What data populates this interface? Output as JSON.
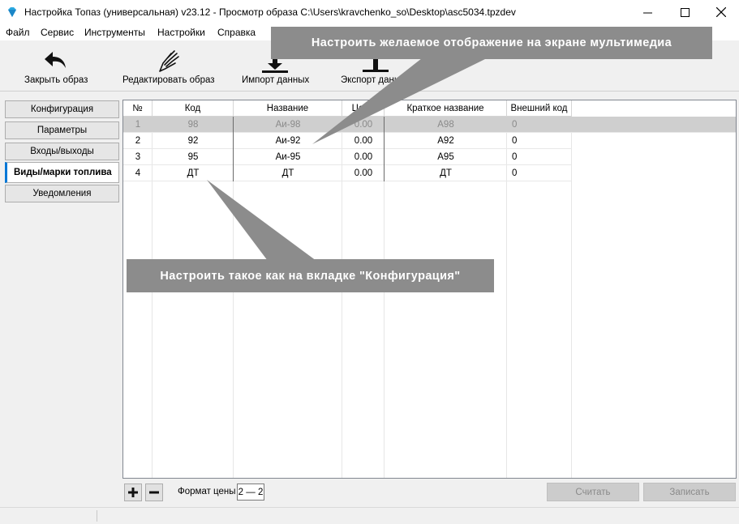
{
  "window": {
    "title": "Настройка Топаз (универсальная) v23.12 - Просмотр образа C:\\Users\\kravchenko_so\\Desktop\\asc5034.tpzdev",
    "minimize": "—",
    "maximize": "☐",
    "close": "✕"
  },
  "menu": [
    "Файл",
    "Сервис",
    "Инструменты",
    "Настройки",
    "Справка"
  ],
  "toolbar": {
    "close_image": "Закрыть образ",
    "edit_image": "Редактировать образ",
    "import": "Импорт данных",
    "export": "Экспорт данных"
  },
  "sidebar": {
    "tabs": [
      "Конфигурация",
      "Параметры",
      "Входы/выходы",
      "Виды/марки топлива",
      "Уведомления"
    ],
    "active": "Виды/марки топлива"
  },
  "table": {
    "columns": [
      "№",
      "Код",
      "Название",
      "Цена",
      "Краткое название",
      "Внешний код"
    ],
    "rows": [
      {
        "num": "1",
        "code": "98",
        "name": "Аи-98",
        "price": "0.00",
        "short": "А98",
        "ext": "0"
      },
      {
        "num": "2",
        "code": "92",
        "name": "Аи-92",
        "price": "0.00",
        "short": "А92",
        "ext": "0"
      },
      {
        "num": "3",
        "code": "95",
        "name": "Аи-95",
        "price": "0.00",
        "short": "А95",
        "ext": "0"
      },
      {
        "num": "4",
        "code": "ДТ",
        "name": "ДТ",
        "price": "0.00",
        "short": "ДТ",
        "ext": "0"
      }
    ],
    "selected_row": 1
  },
  "bottom": {
    "add": "+",
    "remove": "−",
    "price_format_label": "Формат цены",
    "price_format_value": "2 — 2",
    "read": "Считать",
    "write": "Записать"
  },
  "annotations": {
    "top": "Настроить желаемое отображение на экране мультимедиа",
    "bottom": "Настроить такое как на вкладке \"Конфигурация\""
  },
  "colors": {
    "accent": "#0078d7",
    "callout": "#8c8c8c",
    "selected_row": "#cfcfcf"
  }
}
